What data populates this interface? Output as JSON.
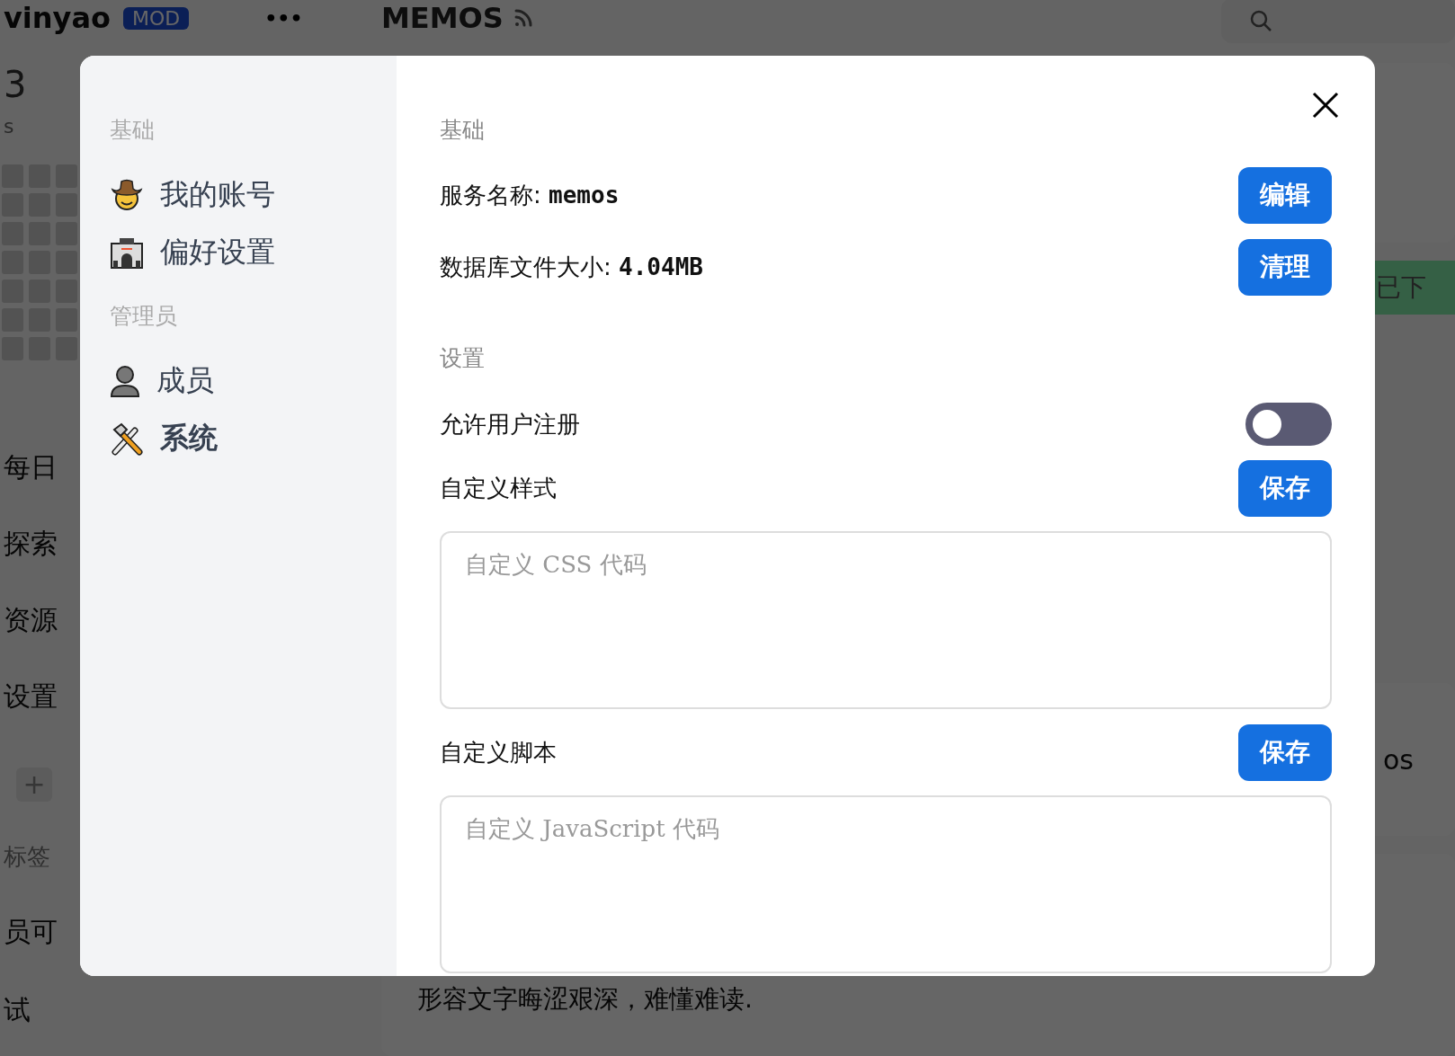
{
  "background": {
    "brand": "vinyao",
    "badge": "MOD",
    "more": "•••",
    "title": "MEMOS",
    "stat": "3",
    "stat_label": "s",
    "nav": [
      "每日",
      "探索",
      "资源",
      "设置"
    ],
    "add": "+",
    "tags_label": "标签",
    "tags": [
      "员可",
      "试"
    ],
    "banner": "已下",
    "side_text": "os",
    "memo_text": "形容文字晦涩艰深，难懂难读."
  },
  "dialog": {
    "sidebar": [
      {
        "heading": "基础",
        "items": [
          {
            "label": "我的账号",
            "selected": false
          },
          {
            "label": "偏好设置",
            "selected": false
          }
        ]
      },
      {
        "heading": "管理员",
        "items": [
          {
            "label": "成员",
            "selected": false
          },
          {
            "label": "系统",
            "selected": true
          }
        ]
      }
    ],
    "sections": [
      {
        "heading": "基础",
        "rows": [
          {
            "kind": "info",
            "label": "服务名称: ",
            "value": "memos",
            "button": "编辑"
          },
          {
            "kind": "info",
            "label": "数据库文件大小: ",
            "value": "4.04MB",
            "button": "清理"
          }
        ]
      },
      {
        "heading": "设置",
        "rows": [
          {
            "kind": "toggle",
            "label": "允许用户注册",
            "on": false
          },
          {
            "kind": "code",
            "label": "自定义样式",
            "button": "保存",
            "placeholder": "自定义 CSS 代码"
          },
          {
            "kind": "code",
            "label": "自定义脚本",
            "button": "保存",
            "placeholder": "自定义 JavaScript 代码"
          }
        ]
      }
    ]
  }
}
